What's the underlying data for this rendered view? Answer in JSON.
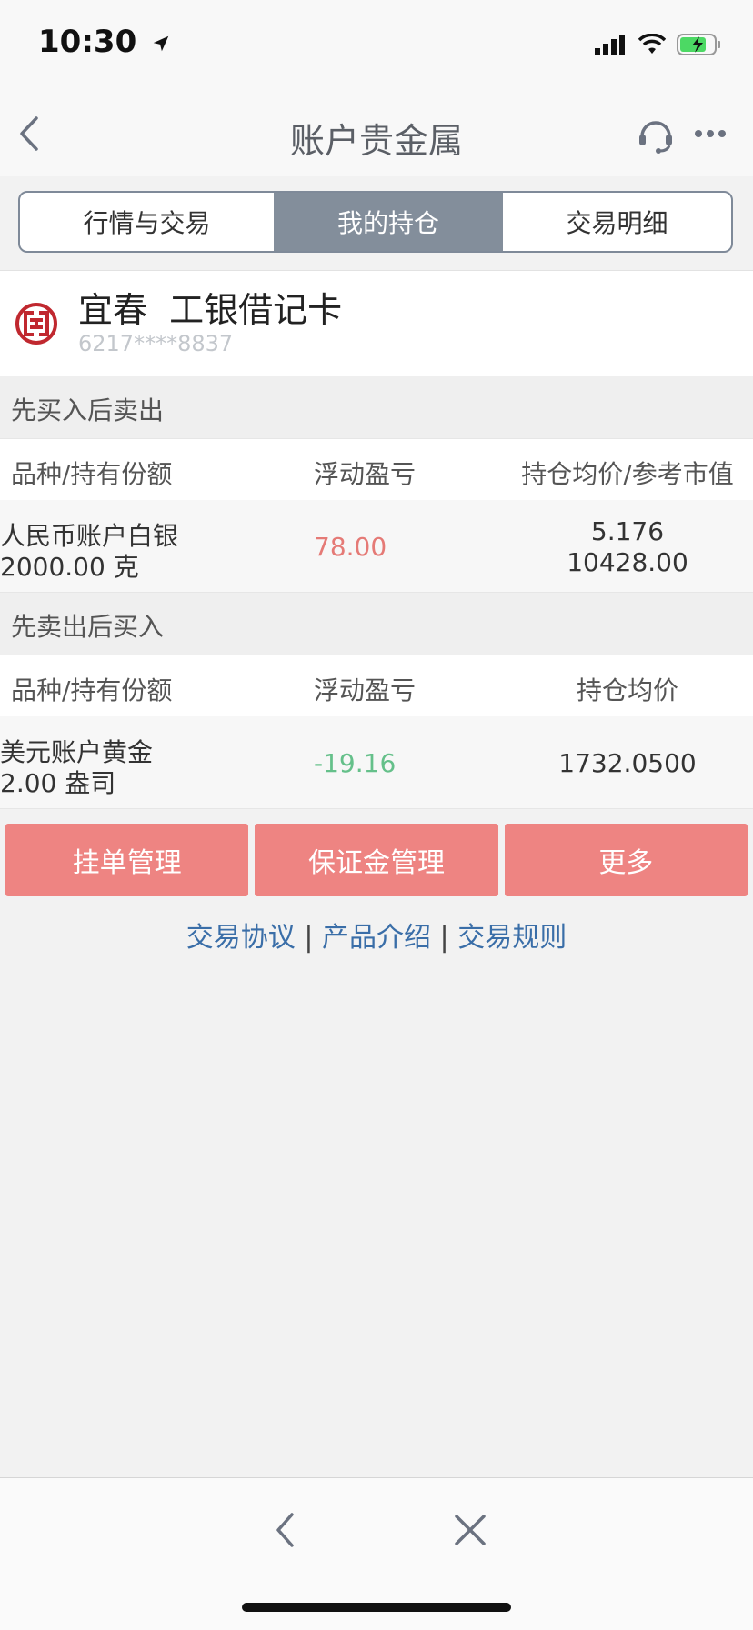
{
  "status_bar": {
    "time": "10:30"
  },
  "nav": {
    "title": "账户贵金属"
  },
  "tabs": [
    {
      "label": "行情与交易",
      "active": false
    },
    {
      "label": "我的持仓",
      "active": true
    },
    {
      "label": "交易明细",
      "active": false
    }
  ],
  "account": {
    "name": "宜春  工银借记卡",
    "card_number": "6217****8837"
  },
  "long_section": {
    "title": "先买入后卖出",
    "headers": [
      "品种/持有份额",
      "浮动盈亏",
      "持仓均价/参考市值"
    ],
    "rows": [
      {
        "product": "人民币账户白银",
        "amount": "2000.00 克",
        "pnl": "78.00",
        "avg_price": "5.176",
        "market_value": "10428.00"
      }
    ]
  },
  "short_section": {
    "title": "先卖出后买入",
    "headers": [
      "品种/持有份额",
      "浮动盈亏",
      "持仓均价"
    ],
    "rows": [
      {
        "product": "美元账户黄金",
        "amount": "2.00 盎司",
        "pnl": "-19.16",
        "avg_price": "1732.0500"
      }
    ]
  },
  "actions": [
    {
      "label": "挂单管理"
    },
    {
      "label": "保证金管理"
    },
    {
      "label": "更多"
    }
  ],
  "links": [
    "交易协议",
    "产品介绍",
    "交易规则"
  ],
  "link_separator": "|",
  "colors": {
    "profit": "#e57a76",
    "loss": "#65c08a",
    "accent_button": "#ee8482",
    "link": "#3a6ea8",
    "bank_logo": "#c0282f"
  }
}
